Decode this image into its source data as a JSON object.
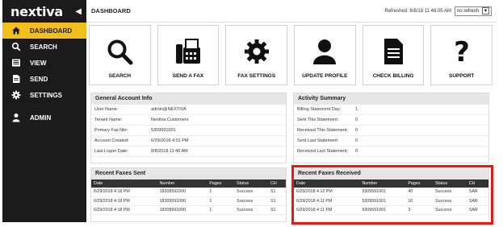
{
  "sidebar": {
    "logo": "nextiva",
    "collapse_icon": "chevron-left-icon",
    "items": [
      {
        "label": "DASHBOARD",
        "icon": "home-icon"
      },
      {
        "label": "SEARCH",
        "icon": "search-icon"
      },
      {
        "label": "VIEW",
        "icon": "inbox-icon"
      },
      {
        "label": "SEND",
        "icon": "document-icon"
      },
      {
        "label": "SETTINGS",
        "icon": "gear-icon"
      },
      {
        "label": "ADMIN",
        "icon": "user-icon"
      }
    ]
  },
  "header": {
    "title": "DASHBOARD",
    "refreshed": "Refreshed: 8/8/18 11:46:05 AM",
    "refresh_option": "no refresh"
  },
  "tiles": [
    {
      "label": "SEARCH",
      "icon": "search-icon"
    },
    {
      "label": "SEND A FAX",
      "icon": "fax-icon"
    },
    {
      "label": "FAX SETTINGS",
      "icon": "gear-icon"
    },
    {
      "label": "UPDATE PROFILE",
      "icon": "person-icon"
    },
    {
      "label": "CHECK BILLING",
      "icon": "document-icon"
    },
    {
      "label": "SUPPORT",
      "icon": "question-icon"
    }
  ],
  "general": {
    "title": "General Account Info",
    "rows": [
      {
        "k": "User Name:",
        "v": "admin@NEXTIVA"
      },
      {
        "k": "Tenant Name:",
        "v": "Nextiva Customers"
      },
      {
        "k": "Primary Fax Nbr:",
        "v": "5309591001"
      },
      {
        "k": "Account Created:",
        "v": "6/29/2018 4:01 PM"
      },
      {
        "k": "Last Logon Date:",
        "v": "8/8/2018 11:46 AM"
      }
    ]
  },
  "activity": {
    "title": "Activity Summary",
    "rows": [
      {
        "k": "Billing Statement Day:",
        "v": "1"
      },
      {
        "k": "Sent This Statement:",
        "v": "0"
      },
      {
        "k": "Received This Statement:",
        "v": "0"
      },
      {
        "k": "Sent Last Statement:",
        "v": "0"
      },
      {
        "k": "Received Last Statement:",
        "v": "0"
      }
    ]
  },
  "sent": {
    "title": "Recent Faxes Sent",
    "columns": [
      "Date",
      "Number",
      "Pages",
      "Status",
      "CH"
    ],
    "rows": [
      [
        "6/29/2018 4:18 PM",
        "18309591000",
        "1",
        "Success",
        "S1"
      ],
      [
        "6/29/2018 4:18 PM",
        "18309591000",
        "1",
        "Success",
        "S1"
      ],
      [
        "6/29/2018 4:18 PM",
        "18309591000",
        "1",
        "Success",
        "S1"
      ]
    ]
  },
  "received": {
    "title": "Recent Faxes Received",
    "columns": [
      "Date",
      "Number",
      "Pages",
      "Status",
      "CH"
    ],
    "rows": [
      [
        "6/29/2018 4:12 PM",
        "5309591001",
        "40",
        "Success",
        "SAR"
      ],
      [
        "6/29/2018 4:11 PM",
        "5309591001",
        "10",
        "Success",
        "SAR"
      ],
      [
        "6/29/2018 4:11 PM",
        "5309591001",
        "3",
        "Success",
        "SAR"
      ]
    ]
  },
  "colors": {
    "accent": "#f3bf1f",
    "sidebar": "#1b1b1b",
    "highlight": "#e21b16"
  }
}
